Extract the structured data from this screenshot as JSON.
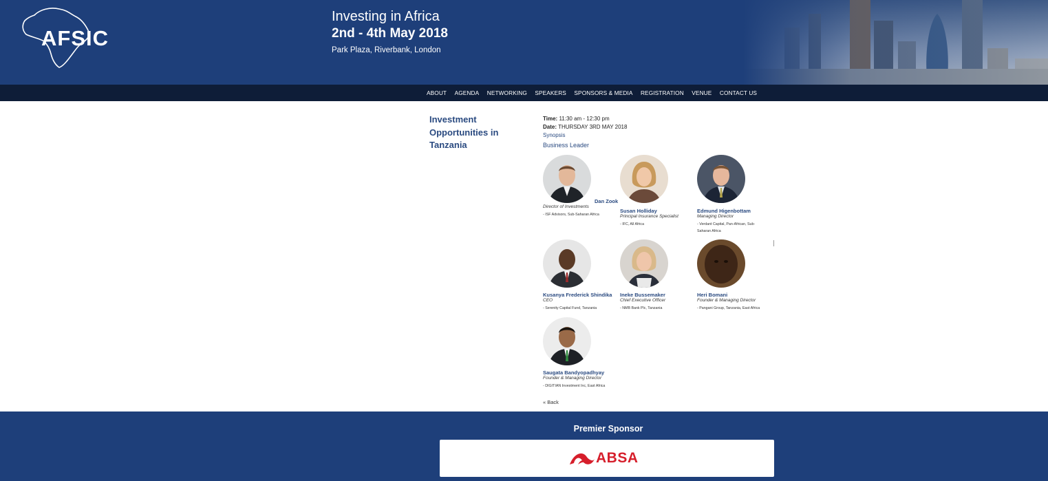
{
  "brand": {
    "logo_text": "AFSIC"
  },
  "event": {
    "title": "Investing in Africa",
    "dates": "2nd - 4th May 2018",
    "venue": "Park Plaza, Riverbank, London"
  },
  "nav": [
    "ABOUT",
    "AGENDA",
    "NETWORKING",
    "SPEAKERS",
    "SPONSORS & MEDIA",
    "REGISTRATION",
    "VENUE",
    "CONTACT US"
  ],
  "session": {
    "title": "Investment Opportunities in Tanzania",
    "time_label": "Time:",
    "time_value": "11:30 am - 12:30 pm",
    "date_label": "Date:",
    "date_value": "THURSDAY 3RD MAY 2018",
    "synopsis_link": "Synopsis",
    "category": "Business Leader",
    "back_link": "« Back"
  },
  "speakers": [
    {
      "name": "Dan Zook",
      "role": "Director of Investments",
      "org": "- ISF Advisors, Sub-Saharan Africa"
    },
    {
      "name": "Susan Holliday",
      "role": "Principal Insurance Specialist",
      "org": "- IFC, All Africa"
    },
    {
      "name": "Edmund Higenbottam",
      "role": "Managing Director",
      "org": "- Verdant Capital, Pan-African, Sub-Saharan Africa"
    },
    {
      "name": "Kusanya Frederick Shindika",
      "role": "CEO",
      "org": "- Serenity Capital Fund, Tanzania"
    },
    {
      "name": "Ineke Bussemaker",
      "role": "Chief Executive Officer",
      "org": "- NMB Bank Plc, Tanzania"
    },
    {
      "name": "Heri Bomani",
      "role": "Founder & Managing Director",
      "org": "- Pangani Group, Tanzania, East Africa"
    },
    {
      "name": "Saugata Bandyopadhyay",
      "role": "Founder & Managing Director",
      "org": "- DIGITIAN Investment Inc, East Africa"
    }
  ],
  "footer": {
    "sponsor_heading": "Premier Sponsor",
    "sponsor_name": "ABSA"
  },
  "colors": {
    "header_bg": "#1e3f7a",
    "nav_bg": "#0e1d38",
    "accent": "#2a4a80",
    "absa_red": "#d61e2b"
  }
}
